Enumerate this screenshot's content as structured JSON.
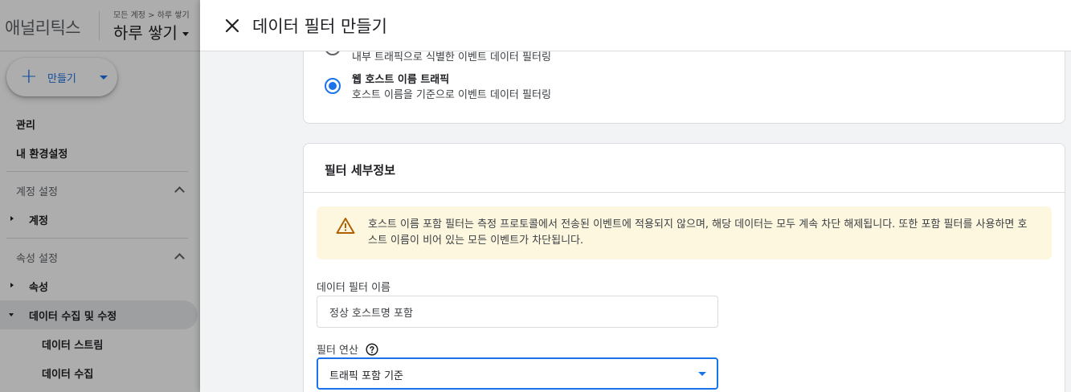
{
  "app": {
    "brand": "애널리틱스",
    "breadcrumb": "모든 계정 > 하루 쌓기",
    "property_name": "하루 쌓기"
  },
  "sidebar": {
    "create_label": "만들기",
    "admin": "관리",
    "preferences": "내 환경설정",
    "account_section": "계정 설정",
    "account_item": "계정",
    "property_section": "속성 설정",
    "property_item": "속성",
    "data_collection": "데이터 수집 및 수정",
    "data_streams": "데이터 스트림",
    "data_collect": "데이터 수집"
  },
  "drawer": {
    "title": "데이터 필터 만들기",
    "filter_type_options": [
      {
        "title": "",
        "desc": "내부 트래픽으로 식별한 이벤트 데이터 필터링",
        "selected": false
      },
      {
        "title": "웹 호스트 이름 트래픽",
        "desc": "호스트 이름을 기준으로 이벤트 데이터 필터링",
        "selected": true
      }
    ],
    "details": {
      "title": "필터 세부정보",
      "warning": "호스트 이름 포함 필터는 측정 프로토콜에서 전송된 이벤트에 적용되지 않으며, 해당 데이터는 모두 계속 차단 해제됩니다. 또한 포함 필터를 사용하면 호스트 이름이 비어 있는 모든 이벤트가 차단됩니다.",
      "name_label": "데이터 필터 이름",
      "name_value": "정상 호스트명 포함",
      "operation_label": "필터 연산",
      "operation_value": "트래픽 포함 기준"
    }
  },
  "colors": {
    "accent": "#1a73e8",
    "warning_bg": "#fef7e0",
    "warning_icon": "#b06000"
  }
}
